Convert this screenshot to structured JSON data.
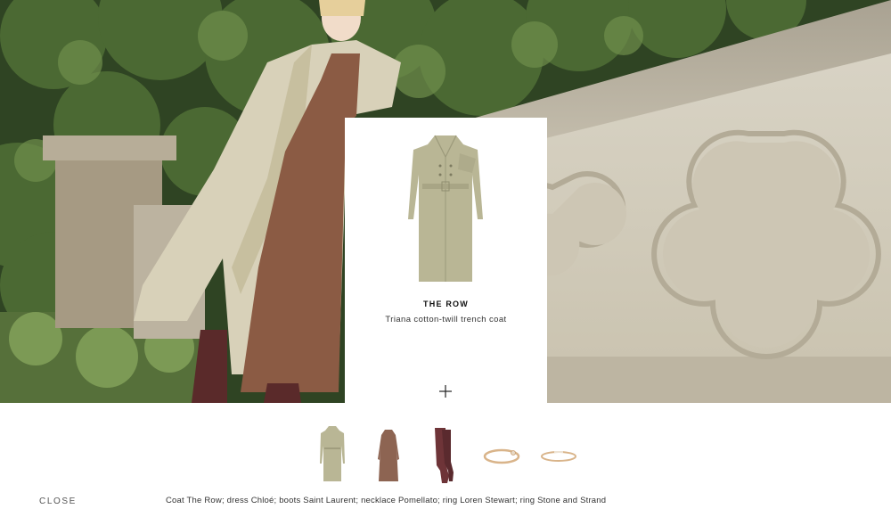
{
  "product_card": {
    "brand": "THE ROW",
    "name": "Triana cotton-twill trench coat",
    "add_icon": "plus-icon"
  },
  "thumbnails": [
    {
      "item": "trench coat",
      "icon": "coat-icon"
    },
    {
      "item": "knit dress",
      "icon": "dress-icon"
    },
    {
      "item": "knee boots",
      "icon": "boots-icon"
    },
    {
      "item": "ring",
      "icon": "ring-icon"
    },
    {
      "item": "ring",
      "icon": "ring-icon"
    }
  ],
  "footer": {
    "close_label": "CLOSE",
    "credits": "Coat The Row; dress Chloé; boots Saint Laurent; necklace Pomellato; ring Loren Stewart; ring Stone and Strand"
  },
  "colors": {
    "coat": "#b8b593",
    "dress": "#8a5a43",
    "boots": "#6b2f2f",
    "ring": "#d9b48a",
    "stone_wall": "#d8d2c2",
    "foliage": "#3e5a2a"
  }
}
